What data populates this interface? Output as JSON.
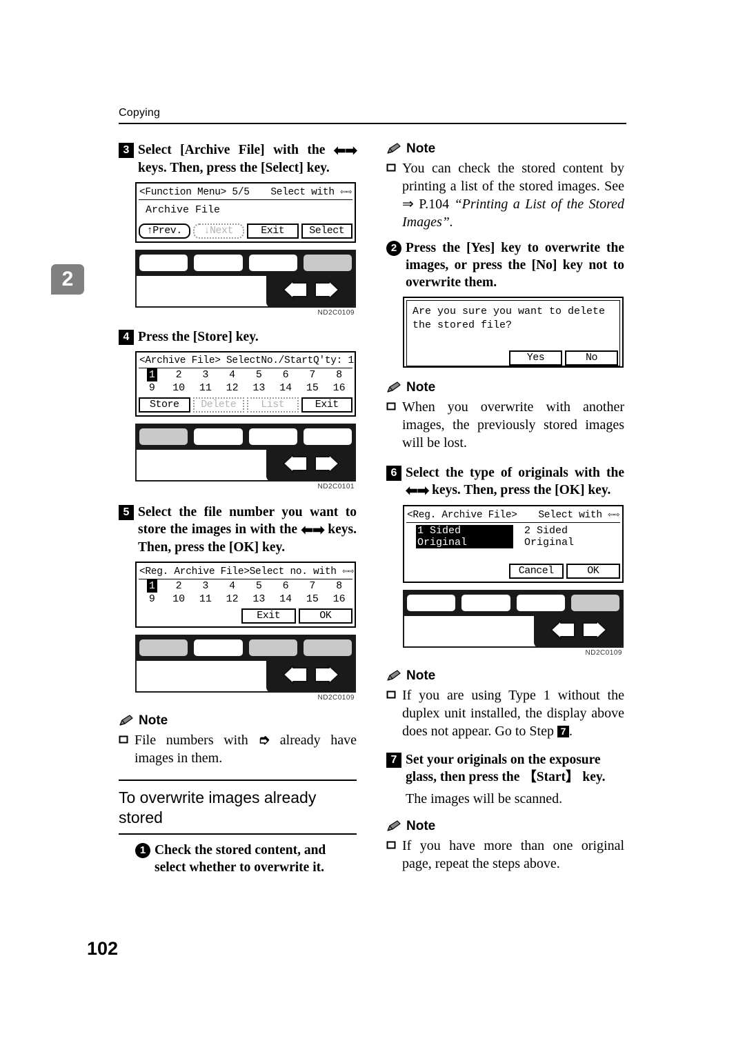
{
  "running_head": "Copying",
  "chapter_tab": "2",
  "folio": "102",
  "left_column": {
    "step3": {
      "num": "3",
      "text_a": "Select [Archive File] with the ",
      "arrows": "⬅➡",
      "text_b": " keys. Then, press the [Select] key."
    },
    "lcd_function_menu": {
      "title_left": "<Function Menu> 5/5",
      "title_right": "Select with ⇦⇨",
      "line": "Archive File",
      "buttons": [
        "↑Prev.",
        "↓Next",
        "Exit",
        "Select"
      ],
      "disabled_buttons": [
        "↓Next"
      ]
    },
    "keypanel_1": {
      "code": "ND2C0109",
      "highlighted_key": 4
    },
    "step4": {
      "num": "4",
      "text": "Press the [Store] key."
    },
    "lcd_archive_file": {
      "title_left": "<Archive File> SelectNo./Start",
      "title_right": "Q'ty:   1",
      "numbers": [
        "1",
        "2",
        "3",
        "4",
        "5",
        "6",
        "7",
        "8",
        "9",
        "10",
        "11",
        "12",
        "13",
        "14",
        "15",
        "16"
      ],
      "selected_number": "1",
      "buttons": [
        "Store",
        "Delete",
        "List",
        "Exit"
      ],
      "disabled_buttons": [
        "Delete",
        "List"
      ]
    },
    "keypanel_2": {
      "code": "ND2C0101",
      "highlighted_key": 1
    },
    "step5": {
      "num": "5",
      "text_a": "Select the file number you want to store the images in with the ",
      "arrows": "⬅➡",
      "text_b": " keys. Then, press the [OK] key."
    },
    "lcd_reg_archive_file": {
      "title_left": "<Reg. Archive File>",
      "title_mid": "Select no. with",
      "title_right": "⇦⇨",
      "numbers": [
        "1",
        "2",
        "3",
        "4",
        "5",
        "6",
        "7",
        "8",
        "9",
        "10",
        "11",
        "12",
        "13",
        "14",
        "15",
        "16"
      ],
      "selected_number": "1",
      "buttons": [
        "Exit",
        "OK"
      ]
    },
    "keypanel_3": {
      "code": "ND2C0109",
      "highlighted_key": 4
    },
    "note_file_numbers": {
      "heading": "Note",
      "text_a": "File numbers with ",
      "glyph": "➮",
      "text_b": " already have images in them."
    },
    "section": {
      "title": "To overwrite images already stored",
      "step1": {
        "num": "1",
        "text": "Check the stored content, and select whether to overwrite it."
      }
    }
  },
  "right_column": {
    "note_check_stored": {
      "heading": "Note",
      "text": "You can check the stored content by printing a list of the stored images. See ⇒ ",
      "ref_plain": "P.104 ",
      "ref_italic": "“Printing a List of the Stored Images”."
    },
    "step2": {
      "num": "2",
      "text": "Press the [Yes] key to overwrite the images, or press the [No] key not to overwrite them."
    },
    "lcd_confirm": {
      "message_line1": "Are you sure you want to delete",
      "message_line2": "the stored file?",
      "buttons": [
        "Yes",
        "No"
      ]
    },
    "note_overwrite": {
      "heading": "Note",
      "text": "When you overwrite with another images, the previously stored images will be lost."
    },
    "step6": {
      "num": "6",
      "text_a": "Select the type of originals with the ",
      "arrows": "⬅➡",
      "text_b": " keys. Then, press the [OK] key."
    },
    "lcd_original_type": {
      "title_left": "<Reg. Archive File>",
      "title_right": "Select with ⇦⇨",
      "options": [
        "1 Sided Original",
        "2 Sided Original"
      ],
      "selected_option": "1 Sided Original",
      "buttons": [
        "Cancel",
        "OK"
      ]
    },
    "keypanel_4": {
      "code": "ND2C0109",
      "highlighted_key": 4
    },
    "note_type1": {
      "heading": "Note",
      "text_a": "If you are using Type 1 without the duplex unit installed, the display above does not appear. Go to Step ",
      "step_ref": "7",
      "text_b": "."
    },
    "step7": {
      "num": "7",
      "text": "Set your originals on the exposure glass, then press the 【Start】 key.",
      "follow": "The images will be scanned."
    },
    "note_multi_page": {
      "heading": "Note",
      "text": "If you have more than one original page, repeat the steps above."
    }
  }
}
